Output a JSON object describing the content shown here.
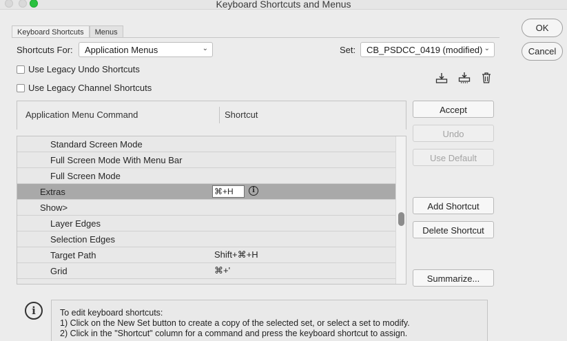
{
  "window": {
    "title": "Keyboard Shortcuts and Menus"
  },
  "tabs": [
    {
      "label": "Keyboard Shortcuts",
      "active": true
    },
    {
      "label": "Menus",
      "active": false
    }
  ],
  "shortcuts_for": {
    "label": "Shortcuts For:",
    "value": "Application Menus"
  },
  "set": {
    "label": "Set:",
    "value": "CB_PSDCC_0419 (modified)"
  },
  "options": {
    "legacy_undo": {
      "label": "Use Legacy Undo Shortcuts",
      "checked": false
    },
    "legacy_channel": {
      "label": "Use Legacy Channel Shortcuts",
      "checked": false
    }
  },
  "icons": [
    "save-set-icon",
    "save-set-as-icon",
    "delete-set-icon"
  ],
  "table": {
    "col_command": "Application Menu Command",
    "col_shortcut": "Shortcut",
    "rows": [
      {
        "command": "Standard Screen Mode",
        "shortcut": "",
        "indent": 2
      },
      {
        "command": "Full Screen Mode With Menu Bar",
        "shortcut": "",
        "indent": 2
      },
      {
        "command": "Full Screen Mode",
        "shortcut": "",
        "indent": 2
      },
      {
        "command": "Extras",
        "shortcut": "⌘+H",
        "indent": 1,
        "selected": true
      },
      {
        "command": "Show>",
        "shortcut": "",
        "indent": 1
      },
      {
        "command": "Layer Edges",
        "shortcut": "",
        "indent": 2
      },
      {
        "command": "Selection Edges",
        "shortcut": "",
        "indent": 2
      },
      {
        "command": "Target Path",
        "shortcut": "Shift+⌘+H",
        "indent": 2
      },
      {
        "command": "Grid",
        "shortcut": "⌘+'",
        "indent": 2
      }
    ]
  },
  "buttons": {
    "ok": "OK",
    "cancel": "Cancel",
    "accept": "Accept",
    "undo": "Undo",
    "use_default": "Use Default",
    "add_shortcut": "Add Shortcut",
    "delete_shortcut": "Delete Shortcut",
    "summarize": "Summarize..."
  },
  "info": {
    "line1": "To edit keyboard shortcuts:",
    "line2": "1) Click on the New Set button to create a copy of the selected set, or select a set to modify.",
    "line3": "2) Click in the \"Shortcut\" column for a command and press the keyboard shortcut to assign."
  }
}
